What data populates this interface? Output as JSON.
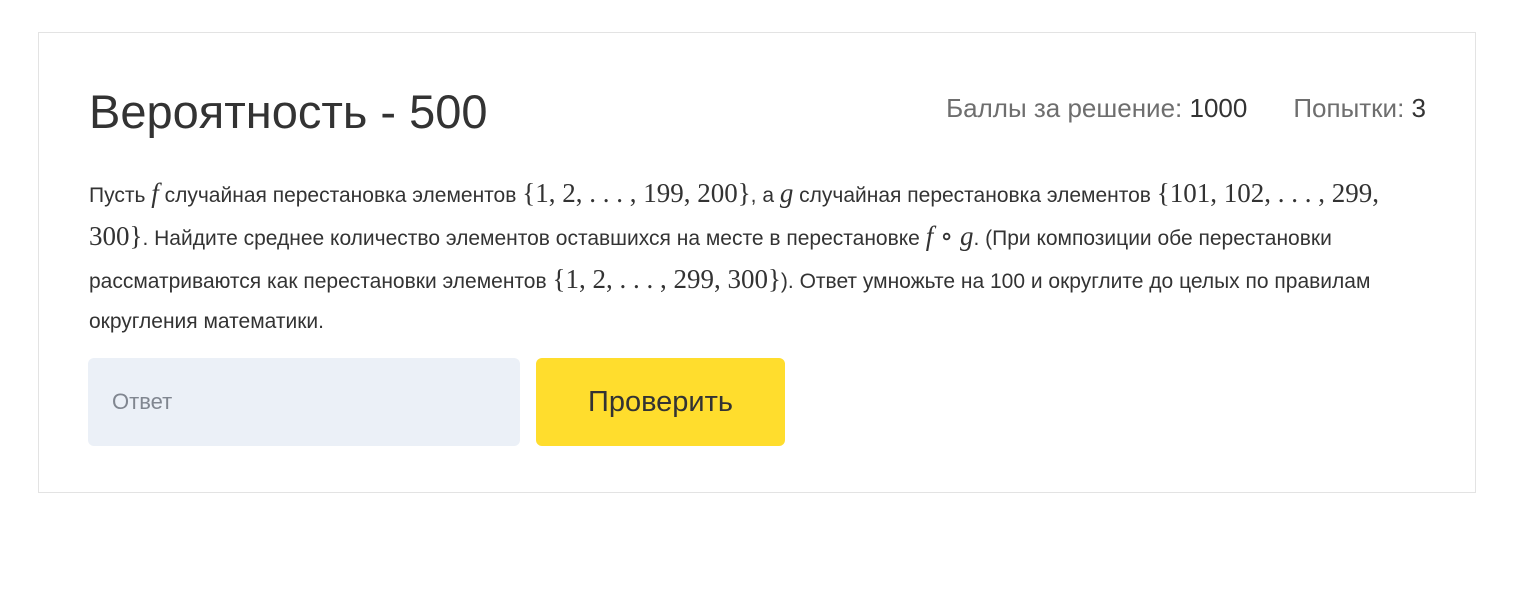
{
  "problem": {
    "title": "Вероятность - 500",
    "score_label": "Баллы за решение:",
    "score_value": "1000",
    "attempts_label": "Попытки:",
    "attempts_value": "3"
  },
  "statement": {
    "t1": "Пусть ",
    "m_f1": "f",
    "t2": " случайная перестановка элементов ",
    "m_set1": "{1, 2, . . . , 199, 200}",
    "t3": ", а ",
    "m_g1": "g",
    "t4": " случайная перестановка элементов ",
    "m_set2": "{101, 102, . . . , 299, 300}",
    "t5": ". Найдите среднее количество элементов оставшихся на месте в перестановке ",
    "m_f2": "f",
    "m_circ": " ∘ ",
    "m_g2": "g",
    "t6": ". (При композиции обе перестановки рассматриваются как перестановки элементов ",
    "m_set3": "{1, 2, . . . , 299, 300}",
    "t7": "). Ответ умножьте на 100 и округлите до целых по правилам округления математики."
  },
  "form": {
    "answer_placeholder": "Ответ",
    "answer_value": "",
    "check_button_label": "Проверить"
  },
  "colors": {
    "accent_button": "#ffdd2d",
    "input_background": "#ebf0f7",
    "card_border": "#e3e3e3",
    "text": "#333333",
    "muted_text": "#6e6e6e"
  }
}
